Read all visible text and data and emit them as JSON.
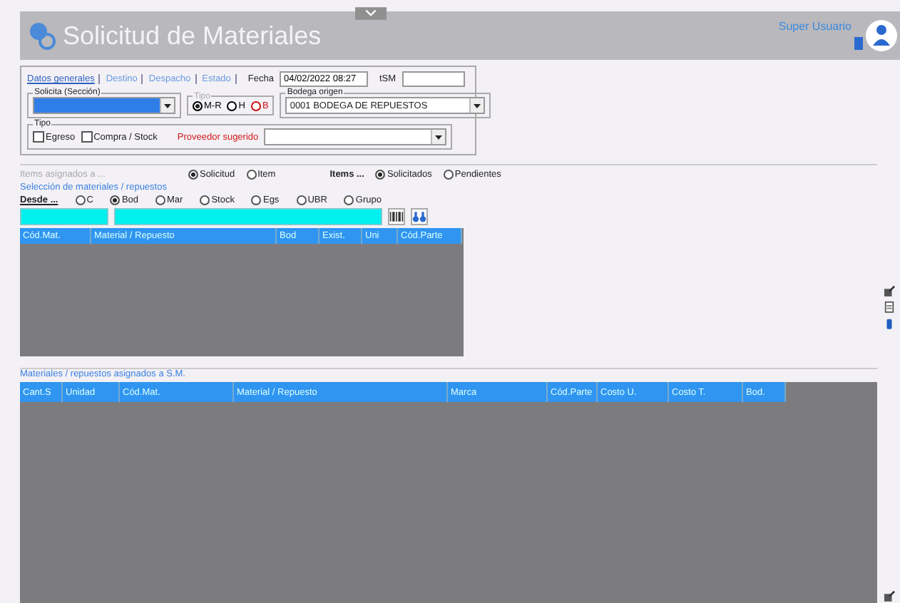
{
  "window": {
    "title": "Solicitud de Materiales",
    "user": "Super Usuario"
  },
  "tabs": [
    {
      "label": "Datos generales",
      "selected": true
    },
    {
      "label": "Destino",
      "selected": false
    },
    {
      "label": "Despacho",
      "selected": false
    },
    {
      "label": "Estado",
      "selected": false
    }
  ],
  "fecha": {
    "label": "Fecha",
    "value": "04/02/2022 08:27"
  },
  "tsm": {
    "label": "tSM"
  },
  "solicita": {
    "label": "Solicita (Sección)"
  },
  "tipo_sm": {
    "label": "Tipo",
    "options": [
      {
        "label": "M-R",
        "selected": true,
        "color": "#000000"
      },
      {
        "label": "H",
        "selected": false,
        "color": "#000000"
      },
      {
        "label": "B",
        "selected": false,
        "color": "#d01010"
      }
    ]
  },
  "bodega": {
    "label": "Bodega origen",
    "value": "0001 BODEGA DE REPUESTOS"
  },
  "tipo": {
    "label": "Tipo",
    "checks": [
      {
        "label": "Egreso",
        "checked": false
      },
      {
        "label": "Compra / Stock",
        "checked": false
      }
    ]
  },
  "proveedor": {
    "label": "Proveedor sugerido"
  },
  "items_asignados": {
    "label": "Items asignados a ...",
    "options": [
      {
        "label": "Solicitud",
        "selected": true
      },
      {
        "label": "Item",
        "selected": false
      }
    ]
  },
  "items": {
    "label": "Items ...",
    "options": [
      {
        "label": "Solicitados",
        "selected": true
      },
      {
        "label": "Pendientes",
        "selected": false
      }
    ]
  },
  "seleccion": {
    "label": "Selección de materiales / repuestos",
    "desde": "Desde ...",
    "options": [
      {
        "label": "C",
        "selected": false
      },
      {
        "label": "Bod",
        "selected": true
      },
      {
        "label": "Mar",
        "selected": false
      },
      {
        "label": "Stock",
        "selected": false
      },
      {
        "label": "Egs",
        "selected": false
      },
      {
        "label": "UBR",
        "selected": false
      },
      {
        "label": "Grupo",
        "selected": false
      }
    ],
    "columns": [
      "Cód.Mat.",
      "Material / Repuesto",
      "Bod",
      "Exist.",
      "Uni",
      "Cód.Parte"
    ]
  },
  "asignados": {
    "label": "Materiales / repuestos asignados a S.M.",
    "columns": [
      "Cant.S",
      "Unidad",
      "Cód.Mat.",
      "Material / Repuesto",
      "Marca",
      "Cód.Parte",
      "Costo U.",
      "Costo T.",
      "Bod."
    ]
  }
}
